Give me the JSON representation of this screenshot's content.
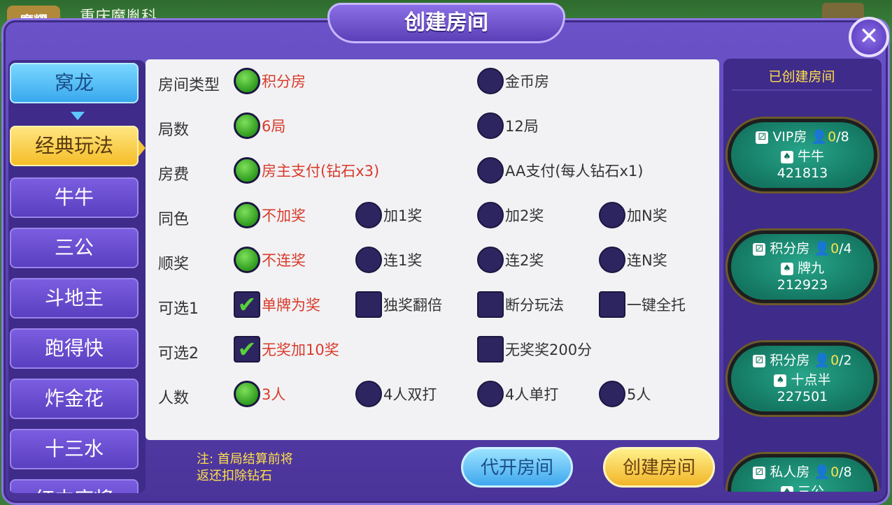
{
  "background": {
    "logo_text": "魔耀",
    "name": "重庆魔胤科..."
  },
  "title": "创建房间",
  "close_symbol": "✕",
  "sidebar": {
    "items": [
      {
        "label": "窝龙",
        "style": "blue"
      },
      {
        "label": "经典玩法",
        "style": "yellow"
      },
      {
        "label": "牛牛",
        "style": "purple"
      },
      {
        "label": "三公",
        "style": "purple"
      },
      {
        "label": "斗地主",
        "style": "purple"
      },
      {
        "label": "跑得快",
        "style": "purple"
      },
      {
        "label": "炸金花",
        "style": "purple"
      },
      {
        "label": "十三水",
        "style": "purple"
      },
      {
        "label": "红中麻将",
        "style": "purple"
      }
    ]
  },
  "settings": {
    "room_type": {
      "label": "房间类型",
      "opt1": "积分房",
      "opt2": "金币房"
    },
    "rounds": {
      "label": "局数",
      "opt1": "6局",
      "opt2": "12局"
    },
    "fee": {
      "label": "房费",
      "opt1": "房主支付(钻石x3)",
      "opt2": "AA支付(每人钻石x1)"
    },
    "same_color": {
      "label": "同色",
      "opt1": "不加奖",
      "opt2": "加1奖",
      "opt3": "加2奖",
      "opt4": "加N奖"
    },
    "sequence": {
      "label": "顺奖",
      "opt1": "不连奖",
      "opt2": "连1奖",
      "opt3": "连2奖",
      "opt4": "连N奖"
    },
    "optional1": {
      "label": "可选1",
      "opt1": "单牌为奖",
      "opt2": "独奖翻倍",
      "opt3": "断分玩法",
      "opt4": "一键全托"
    },
    "optional2": {
      "label": "可选2",
      "opt1": "无奖加10奖",
      "opt2": "无奖奖200分"
    },
    "players": {
      "label": "人数",
      "opt1": "3人",
      "opt2": "4人双打",
      "opt3": "4人单打",
      "opt4": "5人"
    }
  },
  "check_mark": "✔",
  "note": {
    "line1": "注: 首局结算前将",
    "line2": "返还扣除钻石"
  },
  "buttons": {
    "proxy": "代开房间",
    "create": "创建房间"
  },
  "rooms": {
    "title": "已创建房间",
    "list": [
      {
        "type": "VIP房",
        "current": "0",
        "max": "/8",
        "game": "牛牛",
        "id": "421813"
      },
      {
        "type": "积分房",
        "current": "0",
        "max": "/4",
        "game": "牌九",
        "id": "212923"
      },
      {
        "type": "积分房",
        "current": "0",
        "max": "/2",
        "game": "十点半",
        "id": "227501"
      },
      {
        "type": "私人房",
        "current": "0",
        "max": "/8",
        "game": "三公",
        "id": ""
      }
    ]
  },
  "colors": {
    "selected_text": "#d83a2a",
    "note_text": "#ffe04a",
    "panel": "#5840b0",
    "room_felt": "#137560"
  }
}
